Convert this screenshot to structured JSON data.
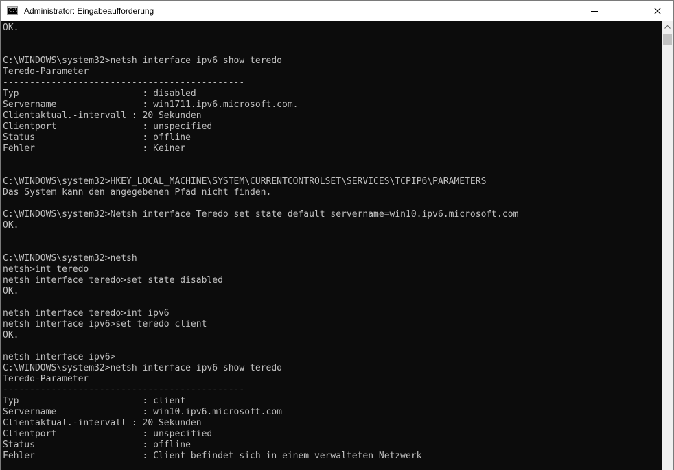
{
  "window": {
    "title": "Administrator: Eingabeaufforderung",
    "icon": "cmd-icon"
  },
  "caption_buttons": {
    "minimize_icon": "minimize-icon",
    "maximize_icon": "maximize-icon",
    "close_icon": "close-icon"
  },
  "console": {
    "background": "#0c0c0c",
    "foreground": "#c0c0c0",
    "lines": [
      "OK.",
      "",
      "",
      "C:\\WINDOWS\\system32>netsh interface ipv6 show teredo",
      "Teredo-Parameter",
      "---------------------------------------------",
      "Typ                       : disabled",
      "Servername                : win1711.ipv6.microsoft.com.",
      "Clientaktual.-intervall : 20 Sekunden",
      "Clientport                : unspecified",
      "Status                    : offline",
      "Fehler                    : Keiner",
      "",
      "",
      "C:\\WINDOWS\\system32>HKEY_LOCAL_MACHINE\\SYSTEM\\CURRENTCONTROLSET\\SERVICES\\TCPIP6\\PARAMETERS",
      "Das System kann den angegebenen Pfad nicht finden.",
      "",
      "C:\\WINDOWS\\system32>Netsh interface Teredo set state default servername=win10.ipv6.microsoft.com",
      "OK.",
      "",
      "",
      "C:\\WINDOWS\\system32>netsh",
      "netsh>int teredo",
      "netsh interface teredo>set state disabled",
      "OK.",
      "",
      "netsh interface teredo>int ipv6",
      "netsh interface ipv6>set teredo client",
      "OK.",
      "",
      "netsh interface ipv6>",
      "C:\\WINDOWS\\system32>netsh interface ipv6 show teredo",
      "Teredo-Parameter",
      "---------------------------------------------",
      "Typ                       : client",
      "Servername                : win10.ipv6.microsoft.com",
      "Clientaktual.-intervall : 20 Sekunden",
      "Clientport                : unspecified",
      "Status                    : offline",
      "Fehler                    : Client befindet sich in einem verwalteten Netzwerk"
    ]
  },
  "scrollbar": {
    "up_icon": "scroll-up-arrow-icon"
  }
}
